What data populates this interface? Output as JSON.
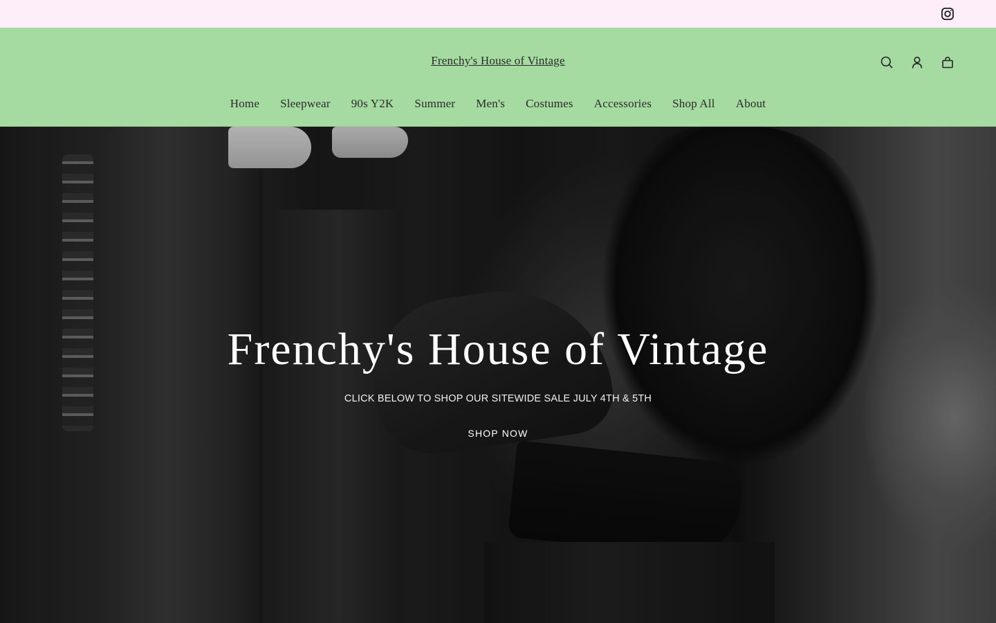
{
  "announcement": {
    "social": {
      "icon": "instagram-icon"
    }
  },
  "header": {
    "title": "Frenchy's House of Vintage",
    "icons": [
      "search-icon",
      "account-icon",
      "cart-icon"
    ],
    "background": "#a5dba1"
  },
  "nav": {
    "items": [
      {
        "label": "Home"
      },
      {
        "label": "Sleepwear"
      },
      {
        "label": "90s Y2K"
      },
      {
        "label": "Summer"
      },
      {
        "label": "Men's"
      },
      {
        "label": "Costumes"
      },
      {
        "label": "Accessories"
      },
      {
        "label": "Shop All"
      },
      {
        "label": "About"
      }
    ]
  },
  "hero": {
    "title": "Frenchy's House of Vintage",
    "subtitle": "CLICK BELOW TO SHOP OUR SITEWIDE SALE JULY 4TH & 5TH",
    "button_label": "SHOP NOW"
  },
  "colors": {
    "announcement_bg": "#fdeefa",
    "header_bg": "#a5dba1",
    "hero_text": "#ffffff"
  }
}
